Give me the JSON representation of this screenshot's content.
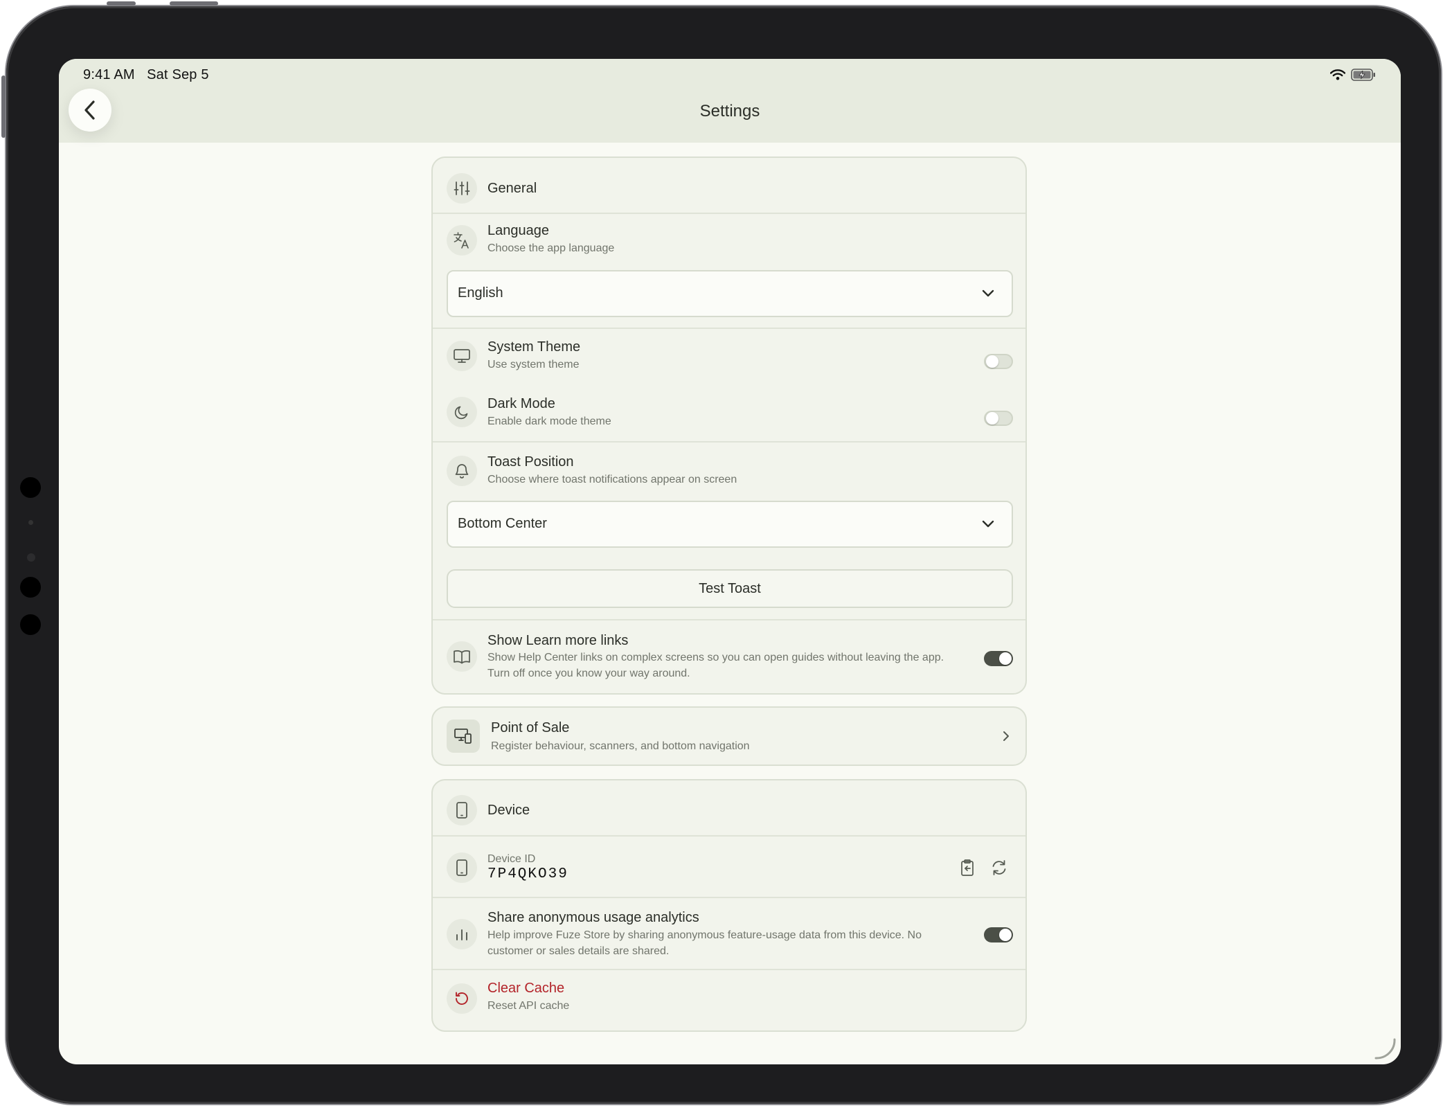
{
  "status_bar": {
    "time": "9:41 AM",
    "date": "Sat Sep 5"
  },
  "header": {
    "title": "Settings"
  },
  "general": {
    "title": "General",
    "language": {
      "title": "Language",
      "subtitle": "Choose the app language",
      "selected": "English"
    },
    "system_theme": {
      "title": "System Theme",
      "subtitle": "Use system theme",
      "enabled": false
    },
    "dark_mode": {
      "title": "Dark Mode",
      "subtitle": "Enable dark mode theme",
      "enabled": false
    },
    "toast_position": {
      "title": "Toast Position",
      "subtitle": "Choose where toast notifications appear on screen",
      "selected": "Bottom Center",
      "test_label": "Test Toast"
    },
    "learn_more": {
      "title": "Show Learn more links",
      "subtitle_line1": "Show Help Center links on complex screens so you can open guides without leaving the app.",
      "subtitle_line2": "Turn off once you know your way around.",
      "enabled": true
    }
  },
  "point_of_sale": {
    "title": "Point of Sale",
    "subtitle": "Register behaviour, scanners, and bottom navigation"
  },
  "device": {
    "title": "Device",
    "device_id_label": "Device ID",
    "device_id_value": "7P4QKO39",
    "analytics": {
      "title": "Share anonymous usage analytics",
      "subtitle_line1": "Help improve Fuze Store by sharing anonymous feature-usage data from this device. No",
      "subtitle_line2": "customer or sales details are shared.",
      "enabled": true
    },
    "clear_cache": {
      "title": "Clear Cache",
      "subtitle": "Reset API cache"
    }
  },
  "colors": {
    "header_bg": "#e7ebdf",
    "screen_bg": "#f9faf4",
    "card_bg": "#f2f4ec",
    "danger": "#b3242a",
    "toggle_on": "#4b4f47"
  },
  "icons": {
    "back": "chevron-left-icon",
    "general": "sliders-icon",
    "language": "translate-icon",
    "system_theme": "monitor-icon",
    "dark_mode": "moon-icon",
    "toast": "bell-icon",
    "learn_more": "book-icon",
    "pos": "register-icon",
    "device": "tablet-icon",
    "copy": "clipboard-icon",
    "refresh": "refresh-icon",
    "analytics": "bar-chart-icon",
    "clear_cache": "rotate-ccw-icon"
  }
}
